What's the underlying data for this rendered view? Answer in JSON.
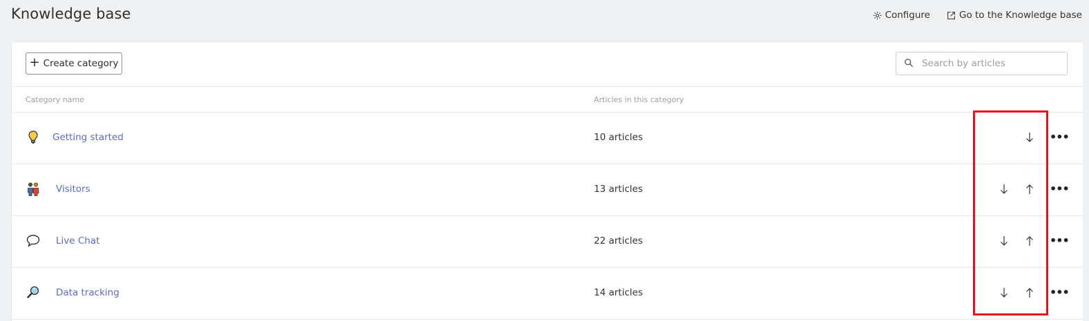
{
  "header": {
    "title": "Knowledge base",
    "configure_label": "Configure",
    "goto_label": "Go to the Knowledge base"
  },
  "toolbar": {
    "create_label": "Create category",
    "search_placeholder": "Search by articles"
  },
  "table": {
    "columns": [
      "Category name",
      "Articles in this category"
    ],
    "rows": [
      {
        "name": "Getting started",
        "count": "10 articles",
        "icon": "lightbulb-icon",
        "has_up": false
      },
      {
        "name": "Visitors",
        "count": "13 articles",
        "icon": "visitors-icon",
        "has_up": true
      },
      {
        "name": "Live Chat",
        "count": "22 articles",
        "icon": "speech-bubble-icon",
        "has_up": true
      },
      {
        "name": "Data tracking",
        "count": "14 articles",
        "icon": "magnifier-icon",
        "has_up": true
      }
    ]
  },
  "colors": {
    "link": "#5c6bc0",
    "highlight": "#e8101c",
    "background": "#f0f1f2"
  }
}
